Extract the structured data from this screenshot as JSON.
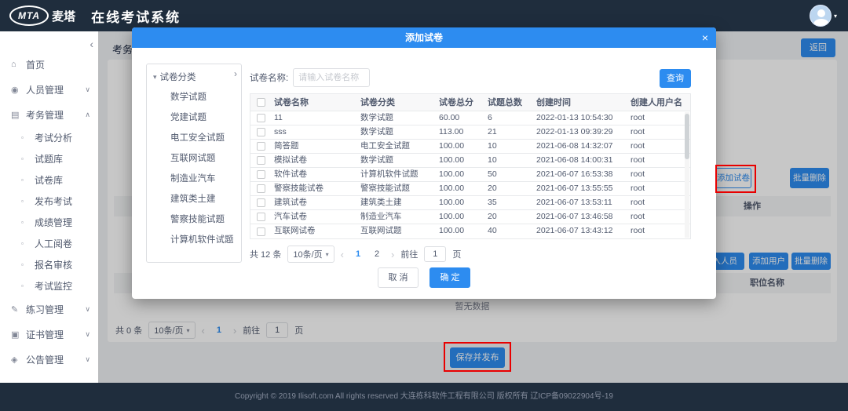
{
  "header": {
    "logo_text": "MTA",
    "logo_cn": "麦塔",
    "app_title": "在线考试系统"
  },
  "sidebar": {
    "collapse_icon": "‹",
    "items": [
      {
        "key": "home",
        "label": "首页",
        "glyph": "⌂"
      },
      {
        "key": "personnel",
        "label": "人员管理",
        "glyph": "◉",
        "chevron": "down"
      },
      {
        "key": "exam-admin",
        "label": "考务管理",
        "glyph": "▤",
        "chevron": "up",
        "children": [
          {
            "key": "exam-analysis",
            "label": "考试分析",
            "glyph": "▫"
          },
          {
            "key": "question-bank",
            "label": "试题库",
            "glyph": "▫"
          },
          {
            "key": "paper-bank",
            "label": "试卷库",
            "glyph": "▫"
          },
          {
            "key": "publish-exam",
            "label": "发布考试",
            "glyph": "▫"
          },
          {
            "key": "score-mgmt",
            "label": "成绩管理",
            "glyph": "▫"
          },
          {
            "key": "manual-marking",
            "label": "人工阅卷",
            "glyph": "▫"
          },
          {
            "key": "registration-review",
            "label": "报名审核",
            "glyph": "▫"
          },
          {
            "key": "exam-monitor",
            "label": "考试监控",
            "glyph": "▫"
          }
        ]
      },
      {
        "key": "practice",
        "label": "练习管理",
        "glyph": "✎",
        "chevron": "down"
      },
      {
        "key": "certificate",
        "label": "证书管理",
        "glyph": "▣",
        "chevron": "down"
      },
      {
        "key": "announcement",
        "label": "公告管理",
        "glyph": "◈",
        "chevron": "down"
      }
    ]
  },
  "page": {
    "tab_label": "考务",
    "return_button": "返回",
    "add_paper_button": "添加试卷",
    "batch_delete_button": "批量删除",
    "ops_column_header": "操作",
    "join_personnel_button": "加入人员",
    "add_user_button": "添加用户",
    "batch_delete_button_2": "批量删除",
    "position_column_header": "职位名称",
    "empty_text": "暂无数据",
    "pagination": {
      "total": "共 0 条",
      "page_size": "10条/页",
      "page": "1",
      "goto_label": "前往",
      "goto_value": "1",
      "page_suffix": "页"
    },
    "save_publish_button": "保存并发布"
  },
  "modal": {
    "title": "添加试卷",
    "close_icon": "×",
    "tree": {
      "root_label": "试卷分类",
      "items": [
        "数学试题",
        "党建试题",
        "电工安全试题",
        "互联网试题",
        "制造业汽车",
        "建筑类土建",
        "警察技能试题",
        "计算机软件试题"
      ]
    },
    "search": {
      "label": "试卷名称:",
      "placeholder": "请输入试卷名称",
      "button": "查询"
    },
    "table": {
      "headers": [
        "试卷名称",
        "试卷分类",
        "试卷总分",
        "试题总数",
        "创建时间",
        "创建人用户名"
      ],
      "rows": [
        {
          "name": "11",
          "category": "数学试题",
          "score": "60.00",
          "count": "6",
          "created": "2022-01-13 10:54:30",
          "creator": "root"
        },
        {
          "name": "sss",
          "category": "数学试题",
          "score": "113.00",
          "count": "21",
          "created": "2022-01-13 09:39:29",
          "creator": "root"
        },
        {
          "name": "简答题",
          "category": "电工安全试题",
          "score": "100.00",
          "count": "10",
          "created": "2021-06-08 14:32:07",
          "creator": "root"
        },
        {
          "name": "模拟试卷",
          "category": "数学试题",
          "score": "100.00",
          "count": "10",
          "created": "2021-06-08 14:00:31",
          "creator": "root"
        },
        {
          "name": "软件试卷",
          "category": "计算机软件试题",
          "score": "100.00",
          "count": "50",
          "created": "2021-06-07 16:53:38",
          "creator": "root"
        },
        {
          "name": "警察技能试卷",
          "category": "警察技能试题",
          "score": "100.00",
          "count": "20",
          "created": "2021-06-07 13:55:55",
          "creator": "root"
        },
        {
          "name": "建筑试卷",
          "category": "建筑类土建",
          "score": "100.00",
          "count": "35",
          "created": "2021-06-07 13:53:11",
          "creator": "root"
        },
        {
          "name": "汽车试卷",
          "category": "制造业汽车",
          "score": "100.00",
          "count": "20",
          "created": "2021-06-07 13:46:58",
          "creator": "root"
        },
        {
          "name": "互联网试卷",
          "category": "互联网试题",
          "score": "100.00",
          "count": "40",
          "created": "2021-06-07 13:43:12",
          "creator": "root"
        }
      ]
    },
    "pagination": {
      "total": "共 12 条",
      "page_size": "10条/页",
      "pages": [
        "1",
        "2"
      ],
      "goto_label": "前往",
      "goto_value": "1",
      "page_suffix": "页"
    },
    "cancel_button": "取 消",
    "confirm_button": "确 定"
  },
  "footer": {
    "copyright": "Copyright © 2019 Ilisoft.com All rights reserved 大连栋科软件工程有限公司 版权所有 辽ICP备09022904号-19"
  },
  "colors": {
    "primary": "#2d8cf0",
    "header_bg": "#1f2d3d",
    "annotation_red": "#e80000"
  }
}
